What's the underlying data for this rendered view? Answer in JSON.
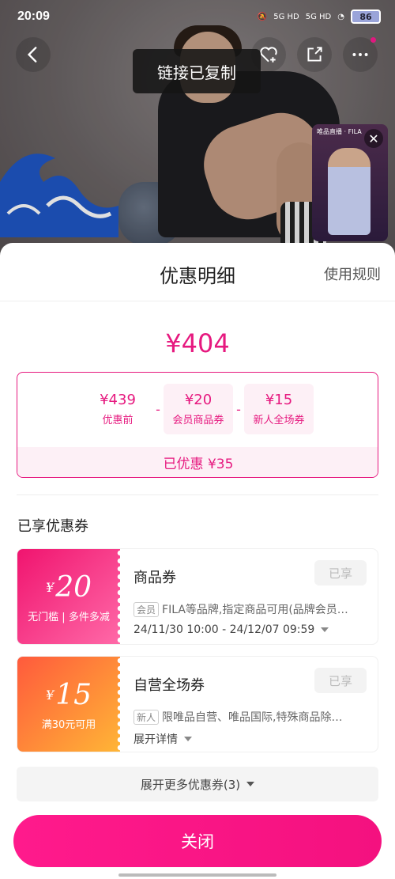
{
  "status_bar": {
    "time": "20:09",
    "network1": "5G HD",
    "network2": "5G HD",
    "battery": "86"
  },
  "toast": {
    "text": "链接已复制"
  },
  "live_preview": {
    "title": "唯品直播 · FILA"
  },
  "sheet": {
    "title": "优惠明细",
    "rules_link": "使用规则",
    "final_price": "¥404",
    "calc": [
      {
        "amount": "¥439",
        "label": "优惠前"
      },
      {
        "amount": "¥20",
        "label": "会员商品券"
      },
      {
        "amount": "¥15",
        "label": "新人全场券"
      }
    ],
    "operator": "-",
    "saved": "已优惠 ¥35",
    "section_title": "已享优惠券",
    "coupons": [
      {
        "yen": "¥",
        "value": "20",
        "condition": "无门槛 | 多件多减",
        "name": "商品券",
        "status": "已享",
        "tag": "会员",
        "desc": "FILA等品牌,指定商品可用(品牌会员…",
        "time": "24/11/30 10:00 - 24/12/07 09:59"
      },
      {
        "yen": "¥",
        "value": "15",
        "condition": "满30元可用",
        "name": "自营全场券",
        "status": "已享",
        "tag": "新人",
        "desc": "限唯品自营、唯品国际,特殊商品除…",
        "time": "展开详情"
      }
    ],
    "expand_more": "展开更多优惠券(3)",
    "close_button": "关闭"
  },
  "colors": {
    "accent": "#e6197f",
    "coupon1_gradient": [
      "#f0146f",
      "#ff6aa8"
    ],
    "coupon2_gradient": [
      "#ff5a3c",
      "#ffb636"
    ]
  },
  "icons": [
    "back-icon",
    "wishlist-add-icon",
    "share-icon",
    "more-icon",
    "close-icon",
    "chevron-down-icon"
  ]
}
